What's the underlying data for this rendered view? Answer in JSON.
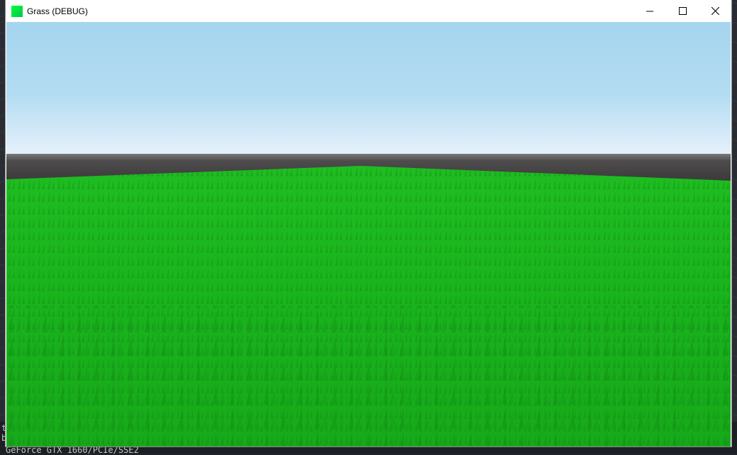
{
  "window": {
    "title": "Grass (DEBUG)",
    "icon": "app-icon",
    "controls": [
      "minimize-icon",
      "maximize-icon",
      "close-icon"
    ]
  },
  "console": {
    "line1": "t",
    "line2": "b",
    "gpu": "GeForce GTX 1660/PCIe/SSE2"
  },
  "colors": {
    "grass": "#19b31c",
    "sky": "#a5d5ef",
    "horizon": "#3a3939",
    "icon": "#00e840"
  }
}
